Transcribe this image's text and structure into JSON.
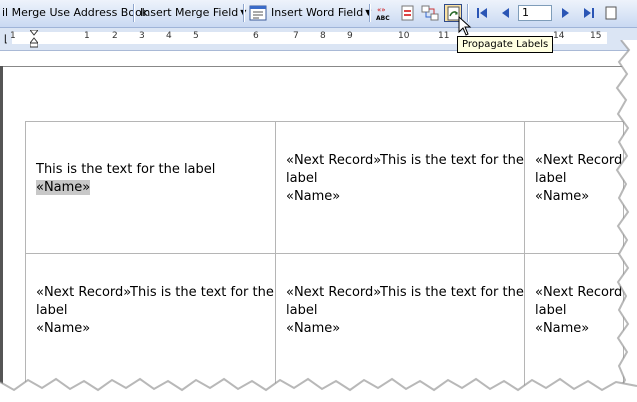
{
  "toolbar": {
    "address_book_label": "il Merge Use Address Book",
    "insert_merge_field_label": "Insert Merge Field",
    "insert_word_field_label": "Insert Word Field",
    "record_number": "1",
    "icons": [
      "highlight-fields-icon",
      "view-merged-data-icon",
      "match-fields-icon",
      "propagate-labels-icon",
      "first-record-icon",
      "previous-record-icon",
      "next-record-icon",
      "last-record-icon",
      "find-entry-icon"
    ]
  },
  "ruler": {
    "numbers": [
      "1",
      "1",
      "2",
      "3",
      "4",
      "5",
      "6",
      "7",
      "8",
      "9",
      "10",
      "11",
      "14",
      "15"
    ]
  },
  "tooltip": {
    "text": "Propagate Labels"
  },
  "labels": {
    "cell_1": {
      "line1": "This is the text for the label",
      "field": "«Name»"
    },
    "cell_2": {
      "line1": "«Next Record»This is the text for the",
      "line2": "label",
      "field": "«Name»"
    },
    "cell_3": {
      "line1": "«Next Record",
      "line2": "label",
      "field": "«Name»"
    },
    "cell_4": {
      "line1": "«Next Record»This is the text for the",
      "line2": "label",
      "field": "«Name»"
    },
    "cell_5": {
      "line1": "«Next Record»This is the text for the",
      "line2": "label",
      "field": "«Name»"
    },
    "cell_6": {
      "line1": "«Next Record",
      "line2": "label",
      "field": "«Name»"
    }
  }
}
